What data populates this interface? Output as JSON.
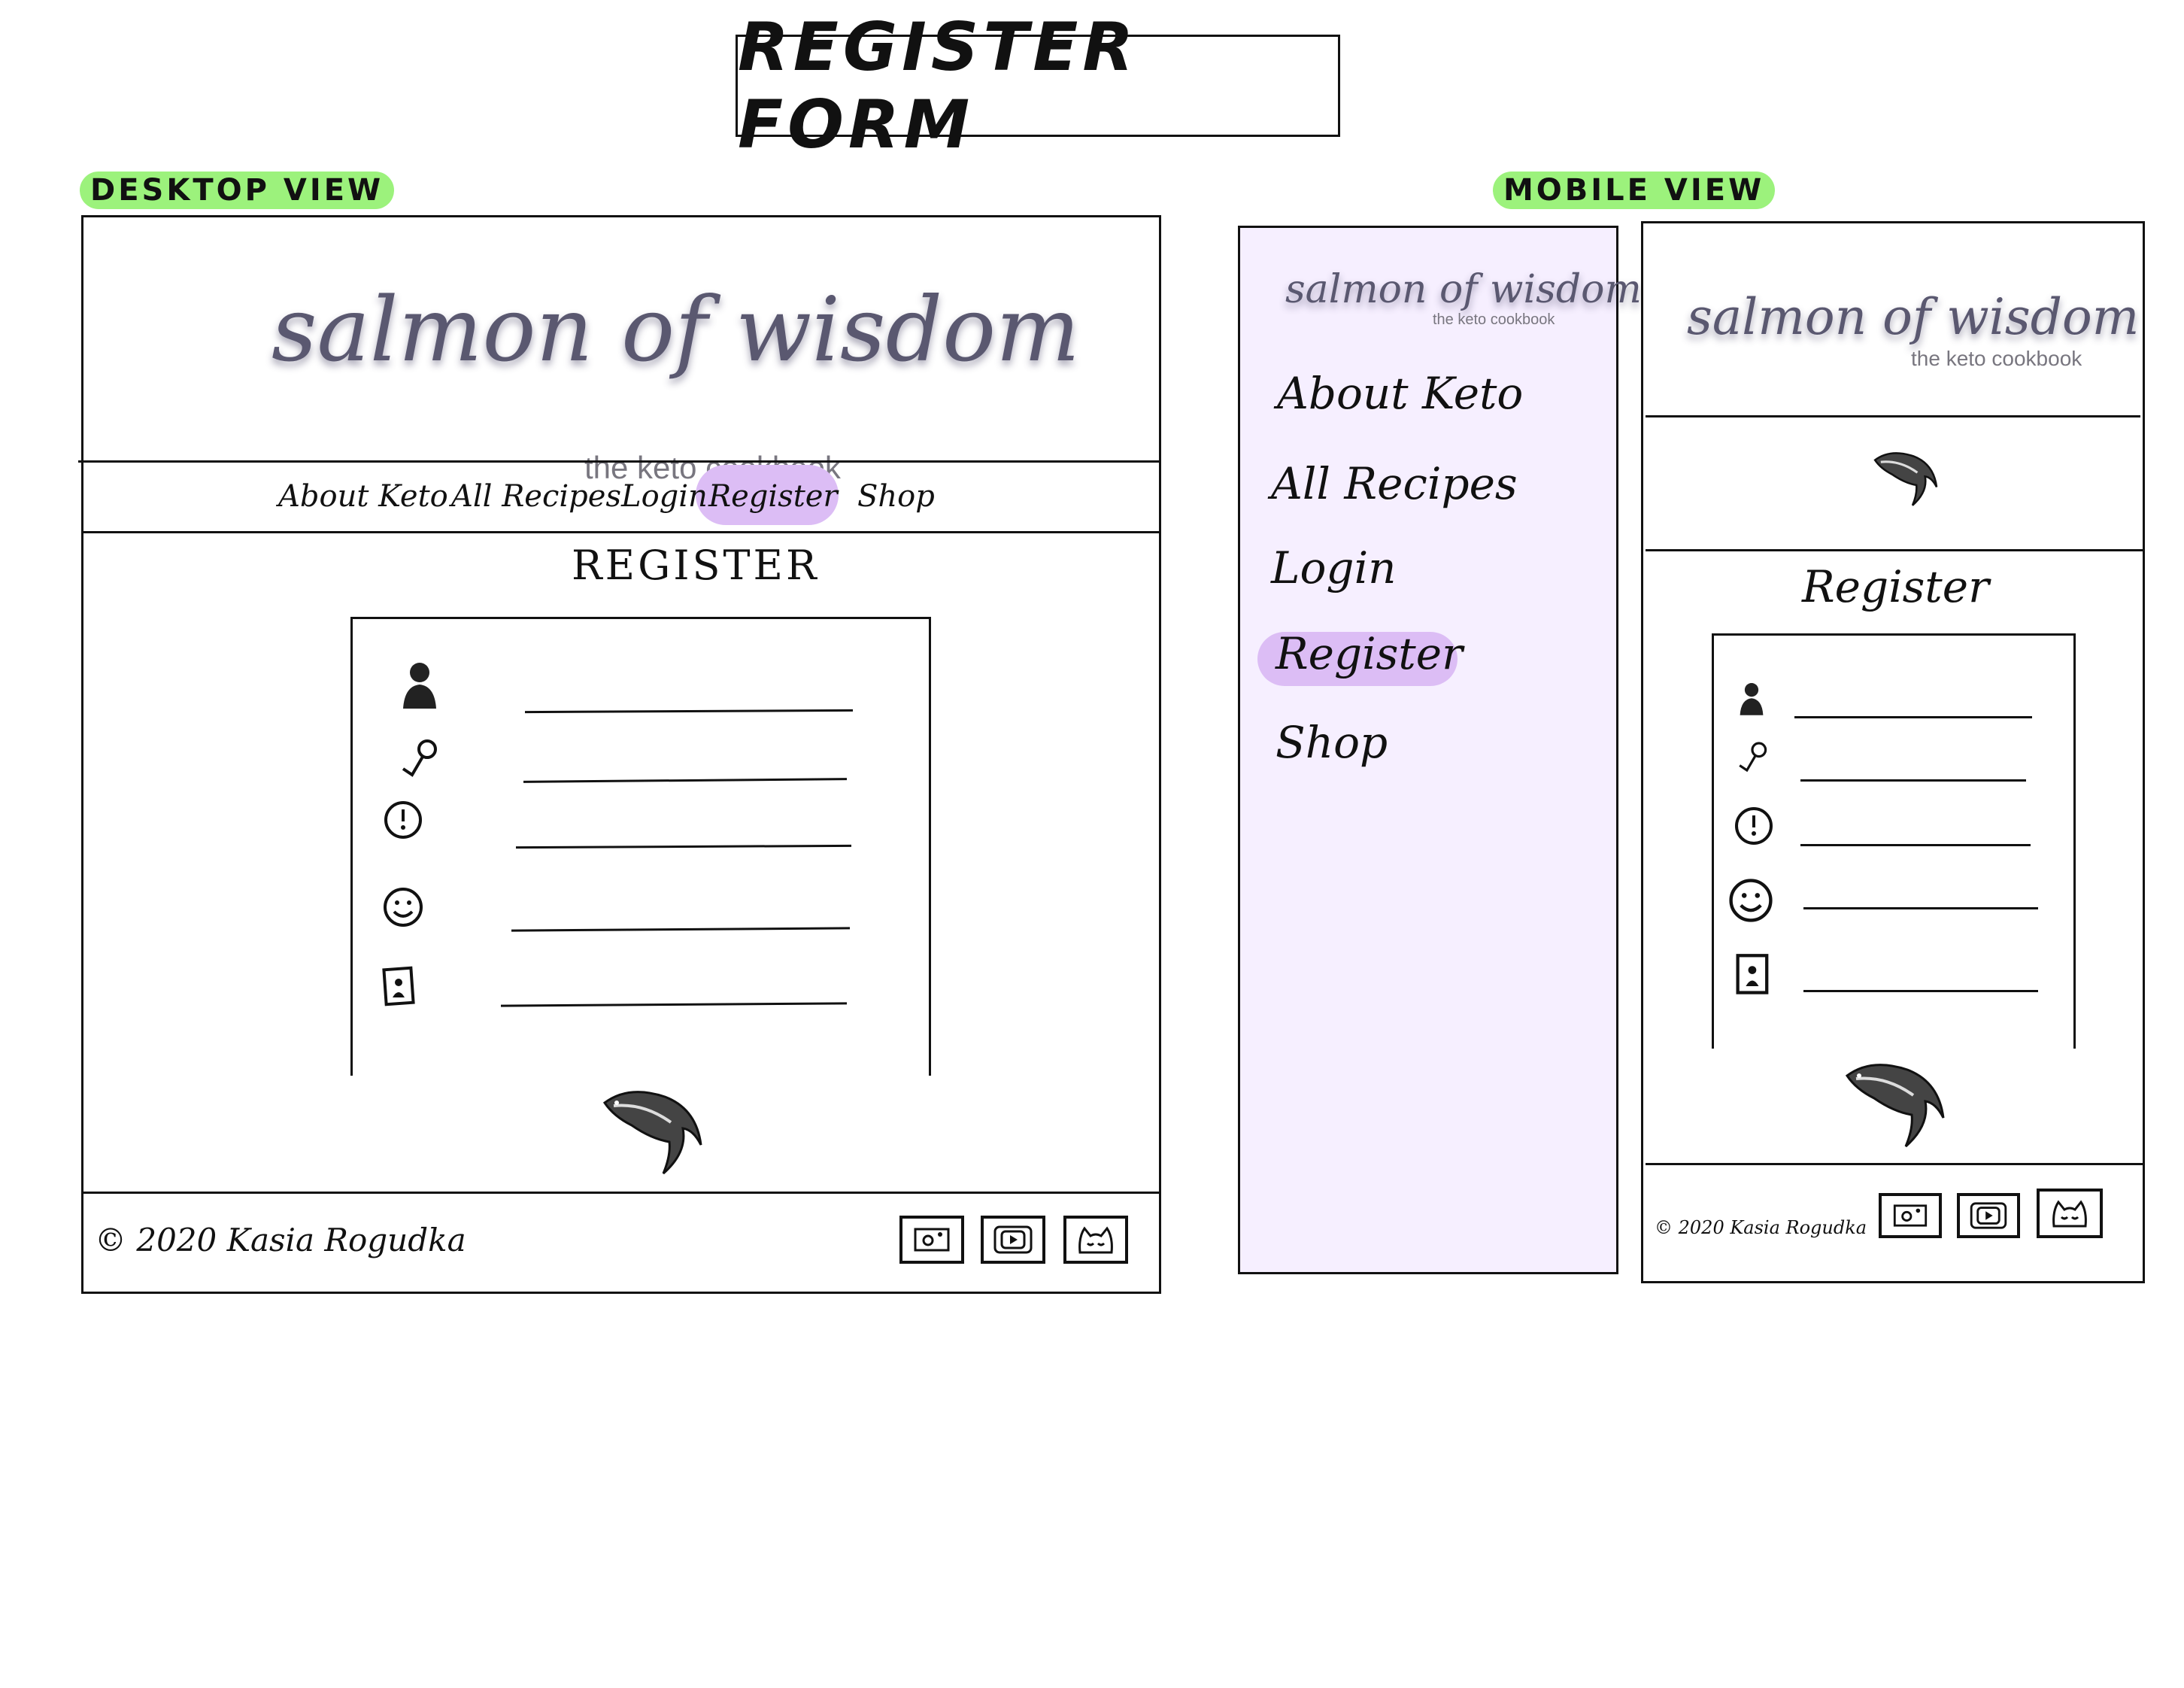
{
  "page": {
    "title": "REGISTER FORM"
  },
  "labels": {
    "desktop": "DESKTOP VIEW",
    "mobile": "MOBILE VIEW"
  },
  "brand": {
    "name": "salmon of wisdom",
    "tagline": "the keto cookbook"
  },
  "nav": {
    "items": [
      "About Keto",
      "All Recipes",
      "Login",
      "Register",
      "Shop"
    ],
    "active": "Register"
  },
  "desktop": {
    "heading": "REGISTER",
    "fields": [
      {
        "icon": "user-icon",
        "value": ""
      },
      {
        "icon": "key-icon",
        "value": ""
      },
      {
        "icon": "alert-icon",
        "value": ""
      },
      {
        "icon": "smiley-icon",
        "value": ""
      },
      {
        "icon": "id-card-icon",
        "value": ""
      }
    ],
    "footer": "© 2020 Kasia Rogudka"
  },
  "mobile": {
    "heading": "Register",
    "footer": "© 2020 Kasia Rogudka"
  },
  "social": [
    "camera-icon",
    "video-icon",
    "cat-icon"
  ],
  "colors": {
    "accent": "#dcbdf5",
    "menu_bg": "#f6efff",
    "tag": "#9cf27c",
    "logo": "#5a5870"
  }
}
